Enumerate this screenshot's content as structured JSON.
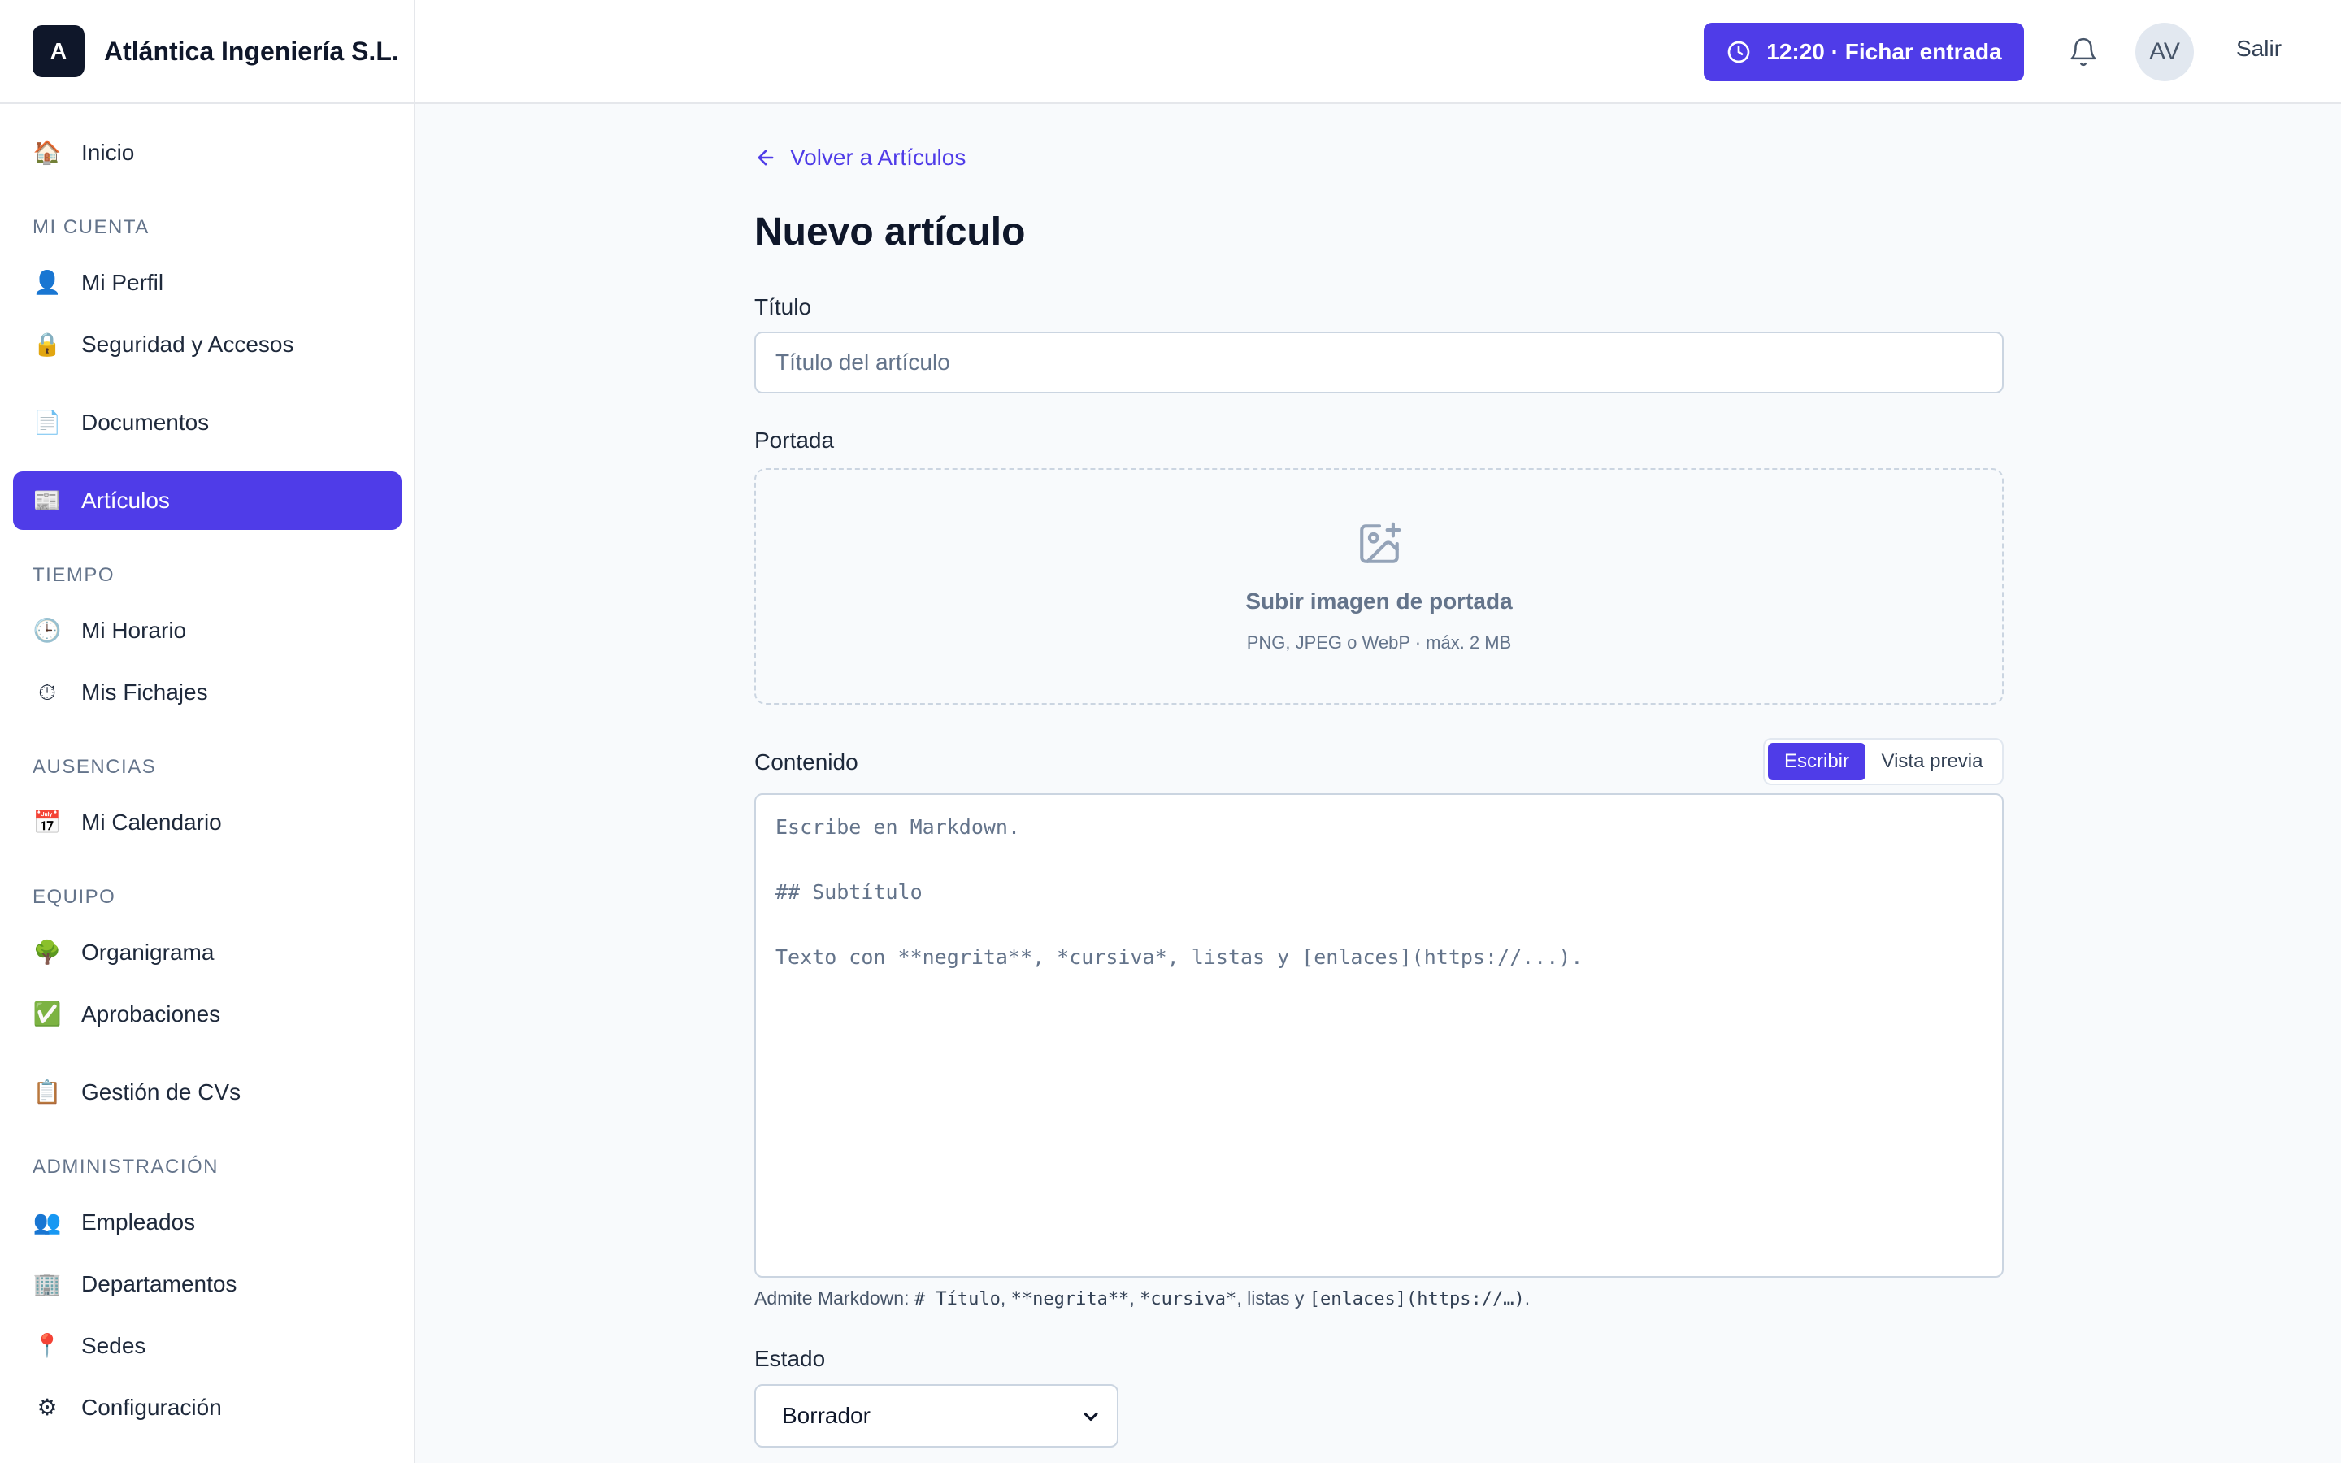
{
  "brand": {
    "logo_letter": "A",
    "name": "Atlántica Ingeniería S.L."
  },
  "sidebar": {
    "sections": {
      "cuenta": "MI CUENTA",
      "tiempo": "TIEMPO",
      "ausencias": "AUSENCIAS",
      "equipo": "EQUIPO",
      "admin": "ADMINISTRACIÓN"
    },
    "items": {
      "inicio": {
        "label": "Inicio",
        "icon": "home-icon"
      },
      "perfil": {
        "label": "Mi Perfil",
        "icon": "user-icon"
      },
      "seguridad": {
        "label": "Seguridad y Accesos",
        "icon": "lock-icon"
      },
      "documentos": {
        "label": "Documentos",
        "icon": "document-icon"
      },
      "articulos": {
        "label": "Artículos",
        "icon": "newspaper-icon"
      },
      "horario": {
        "label": "Mi Horario",
        "icon": "clock-icon"
      },
      "fichajes": {
        "label": "Mis Fichajes",
        "icon": "stopwatch-icon"
      },
      "calendario": {
        "label": "Mi Calendario",
        "icon": "calendar-icon"
      },
      "organigrama": {
        "label": "Organigrama",
        "icon": "tree-icon"
      },
      "aprobaciones": {
        "label": "Aprobaciones",
        "icon": "checkbox-icon"
      },
      "cvs": {
        "label": "Gestión de CVs",
        "icon": "clipboard-icon"
      },
      "empleados": {
        "label": "Empleados",
        "icon": "users-icon"
      },
      "departamentos": {
        "label": "Departamentos",
        "icon": "building-icon"
      },
      "sedes": {
        "label": "Sedes",
        "icon": "pin-icon"
      },
      "configuracion": {
        "label": "Configuración",
        "icon": "gear-icon"
      }
    },
    "active_item": "Artículos"
  },
  "topbar": {
    "clock_button": "12:20  · Fichar entrada",
    "avatar_initials": "AV",
    "logout_label": "Salir"
  },
  "main": {
    "back_link": "Volver a Artículos",
    "title": "Nuevo artículo",
    "titulo_label": "Título",
    "titulo_placeholder": "Título del artículo",
    "portada_label": "Portada",
    "upload_title": "Subir imagen de portada",
    "upload_sub": "PNG, JPEG o WebP · máx. 2 MB",
    "contenido_label": "Contenido",
    "tab_write": "Escribir",
    "tab_preview": "Vista previa",
    "editor_placeholder": "Escribe en Markdown.\n\n## Subtítulo\n\nTexto con **negrita**, *cursiva*, listas y [enlaces](https://...).",
    "hint_prefix": "Admite Markdown: ",
    "hint_code1": "# Título",
    "hint_sep1": ", ",
    "hint_code2": "**negrita**",
    "hint_sep2": ", ",
    "hint_code3": "*cursiva*",
    "hint_sep3": ", listas y ",
    "hint_code4": "[enlaces](https://…)",
    "hint_suffix": ".",
    "estado_label": "Estado",
    "estado_value": "Borrador"
  },
  "colors": {
    "accent": "#4f3ce8",
    "sidebar_bg": "#ffffff",
    "page_bg": "#f8fafc"
  }
}
